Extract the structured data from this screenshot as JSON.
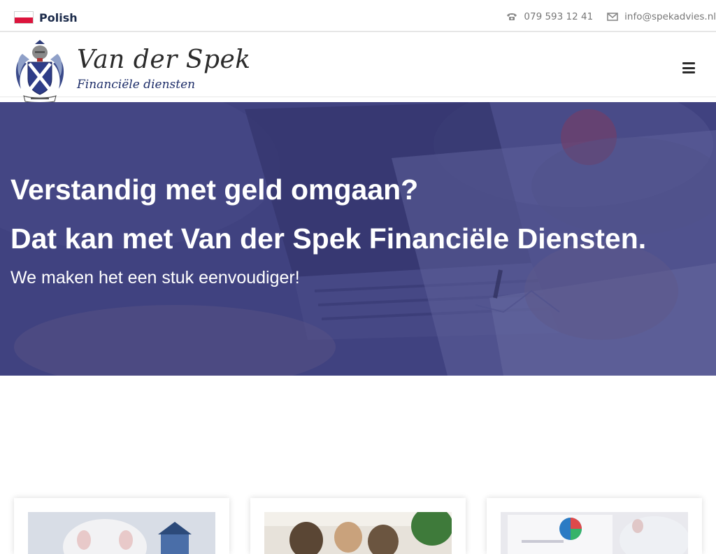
{
  "topbar": {
    "language": "Polish",
    "phone": "079 593 12 41",
    "email": "info@spekadvies.nl",
    "icons": {
      "flag": "poland-flag-icon",
      "phone": "phone-icon",
      "email": "mail-icon"
    }
  },
  "header": {
    "brand_name": "Van der Spek",
    "brand_subtitle": "Financiële diensten",
    "logo": "crest-logo",
    "menu_icon": "hamburger-menu-icon"
  },
  "hero": {
    "title_line1": "Verstandig met geld omgaan?",
    "title_line2": "Dat kan met Van der Spek Financiële Diensten.",
    "subtitle": "We maken het een stuk eenvoudiger!"
  },
  "cards": [
    {
      "image": "piggy-bank-house-photo"
    },
    {
      "image": "family-consultation-photo"
    },
    {
      "image": "finance-report-piggy-bank-photo"
    }
  ],
  "colors": {
    "brand_navy": "#1b2a4a",
    "brand_blue": "#1f2f6a",
    "hero_overlay": "#383a78",
    "flag_red": "#dc143c"
  }
}
